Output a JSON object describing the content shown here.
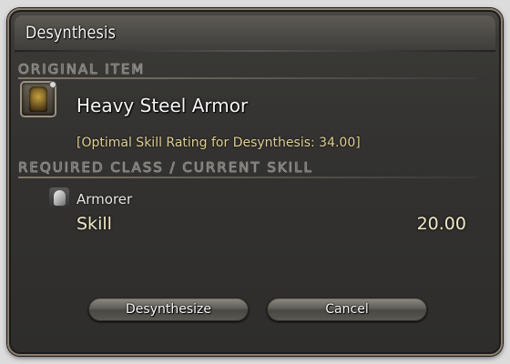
{
  "window": {
    "title": "Desynthesis"
  },
  "original_item": {
    "header": "ORIGINAL ITEM",
    "icon": "armor-icon",
    "name": "Heavy Steel Armor",
    "optimal_text": "[Optimal Skill Rating for Desynthesis: 34.00]"
  },
  "required_class": {
    "header": "REQUIRED CLASS / CURRENT SKILL",
    "icon": "armorer-helm-icon",
    "class_name": "Armorer",
    "skill_label": "Skill",
    "skill_value": "20.00"
  },
  "buttons": {
    "desynthesize": "Desynthesize",
    "cancel": "Cancel"
  },
  "colors": {
    "window_bg": "#333230",
    "border": "#8a8070",
    "section_header": "#6e6c69",
    "optimal_text": "#e0cf95",
    "skill_text": "#f1e8c8"
  }
}
